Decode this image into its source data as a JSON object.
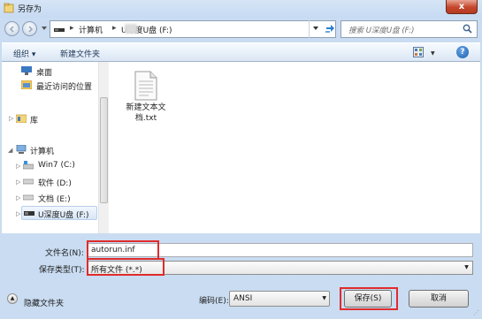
{
  "window": {
    "title": "另存为",
    "close": "x"
  },
  "address": {
    "segments": [
      "计算机",
      "U深度U盘 (F:)"
    ],
    "search_placeholder": "搜索 U深度U盘 (F:)"
  },
  "toolbar": {
    "organize": "组织 ▾",
    "new_folder": "新建文件夹",
    "help": "?"
  },
  "nav": {
    "items": [
      {
        "label": "桌面"
      },
      {
        "label": "最近访问的位置"
      },
      {
        "label": "库"
      },
      {
        "label": "计算机"
      },
      {
        "label": "Win7 (C:)"
      },
      {
        "label": "软件 (D:)"
      },
      {
        "label": "文档 (E:)"
      },
      {
        "label": "U深度U盘 (F:)"
      }
    ]
  },
  "file": {
    "name_line1": "新建文本文",
    "name_line2": "档.txt"
  },
  "form": {
    "filename_label": "文件名(N):",
    "filename_value": "autorun.inf",
    "filetype_label": "保存类型(T):",
    "filetype_value": "所有文件  (*.*)",
    "encoding_label": "编码(E):",
    "encoding_value": "ANSI",
    "save_label": "保存(S)",
    "cancel_label": "取消",
    "hide_folders_label": "隐藏文件夹"
  },
  "colors": {
    "highlight_red": "#e02b2b",
    "title_bg": "#c9dcf1"
  }
}
